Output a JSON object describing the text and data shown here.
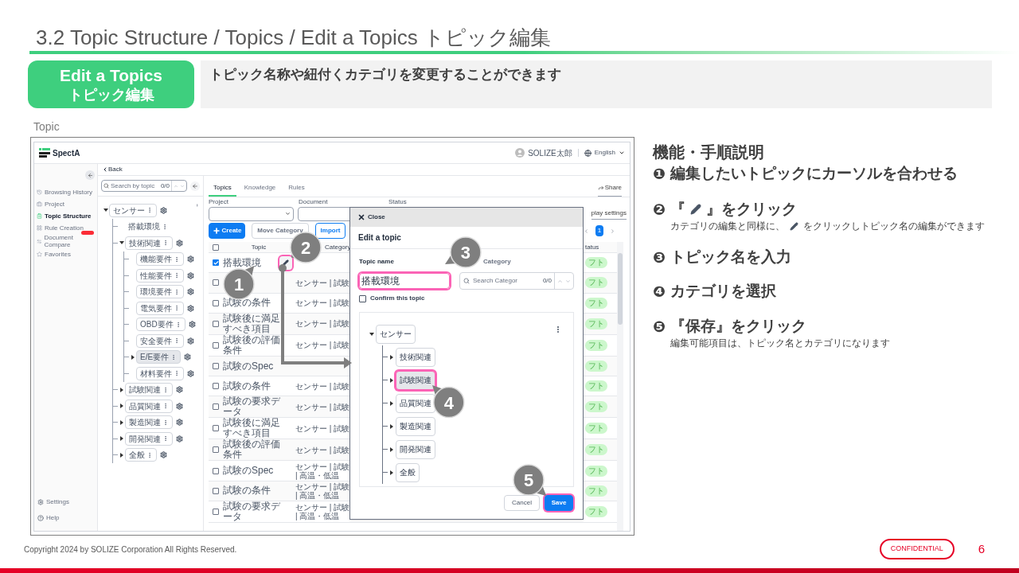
{
  "slide": {
    "title": "3.2 Topic Structure / Topics / Edit a Topics  トピック編集",
    "badge": [
      "Edit a Topics",
      "トピック編集"
    ],
    "summary": "トピック名称や紐付くカテゴリを変更することができます",
    "figure_label": "Topic"
  },
  "app": {
    "logo": "SpectA",
    "user": "SOLIZE太郎",
    "language": "English",
    "nav": [
      {
        "label": "Browsing History",
        "selected": false,
        "badge": false
      },
      {
        "label": "Project",
        "selected": false,
        "badge": false
      },
      {
        "label": "Topic Structure",
        "selected": true,
        "badge": false
      },
      {
        "label": "Rule Creation",
        "selected": false,
        "badge": false
      },
      {
        "label": "Document Compare",
        "selected": false,
        "badge": true
      },
      {
        "label": "Favorites",
        "selected": false,
        "badge": false
      }
    ],
    "nav_footer": [
      "Settings",
      "Help"
    ],
    "back": "Back",
    "tree_search": {
      "placeholder": "Search by topic",
      "count": "0/0"
    },
    "tree": [
      {
        "label": "センサー",
        "kind": "category",
        "expanded": true,
        "selected": false,
        "children": [
          {
            "label": "搭載環境",
            "kind": "topic",
            "selected": false
          },
          {
            "label": "技術関連",
            "kind": "category",
            "expanded": true,
            "selected": false,
            "children": [
              {
                "label": "機能要件",
                "kind": "category",
                "selected": false
              },
              {
                "label": "性能要件",
                "kind": "category",
                "selected": false
              },
              {
                "label": "環境要件",
                "kind": "category",
                "selected": false
              },
              {
                "label": "電気要件",
                "kind": "category",
                "selected": false
              },
              {
                "label": "OBD要件",
                "kind": "category",
                "selected": false
              },
              {
                "label": "安全要件",
                "kind": "category",
                "selected": false
              },
              {
                "label": "E/E要件",
                "kind": "category",
                "expanded": false,
                "selected": true
              },
              {
                "label": "材料要件",
                "kind": "category",
                "selected": false
              }
            ]
          },
          {
            "label": "試験関連",
            "kind": "category",
            "expanded": false,
            "selected": false
          },
          {
            "label": "品質関連",
            "kind": "category",
            "expanded": false,
            "selected": false
          },
          {
            "label": "製造関連",
            "kind": "category",
            "expanded": false,
            "selected": false
          },
          {
            "label": "開発関連",
            "kind": "category",
            "expanded": false,
            "selected": false
          },
          {
            "label": "全般",
            "kind": "category",
            "expanded": false,
            "selected": false
          }
        ]
      }
    ],
    "tabs": [
      {
        "label": "Topics",
        "selected": true
      },
      {
        "label": "Knowledge",
        "selected": false
      },
      {
        "label": "Rules",
        "selected": false
      }
    ],
    "share": "Share",
    "filters": [
      "Project",
      "Document",
      "Status"
    ],
    "actions": [
      {
        "label": "Create",
        "kind": "primary"
      },
      {
        "label": "Move Category",
        "kind": "disabled"
      },
      {
        "label": "Import",
        "kind": "outline"
      }
    ],
    "display_settings": "play settings",
    "page": "1",
    "columns": [
      "Topic",
      "Category",
      "tatus"
    ],
    "select_all": {
      "checked": false
    },
    "rows": [
      {
        "topic": "搭載環境",
        "checked": true,
        "hovered": true,
        "status": "フト"
      },
      {
        "category": [
          "センサー | 試験"
        ],
        "checked": false,
        "hovered": false,
        "status": "フト"
      },
      {
        "topic": "試験の条件",
        "category": [
          "センサー | 試験"
        ],
        "checked": false,
        "hovered": false,
        "status": "フト"
      },
      {
        "topic": "試験後に満足すべき項目",
        "category": [
          "センサー | 試験"
        ],
        "checked": false,
        "hovered": false,
        "status": "フト"
      },
      {
        "topic": "試験後の評価条件",
        "category": [
          "センサー | 試験"
        ],
        "checked": false,
        "hovered": false,
        "status": "フト"
      },
      {
        "topic": "試験のSpec",
        "checked": false,
        "hovered": false,
        "status": "フト"
      },
      {
        "topic": "試験の条件",
        "category": [
          "センサー | 試験"
        ],
        "checked": false,
        "hovered": false,
        "status": "フト"
      },
      {
        "topic": "試験の要求データ",
        "category": [
          "センサー | 試験"
        ],
        "checked": false,
        "hovered": false,
        "status": "フト"
      },
      {
        "topic": "試験後に満足すべき項目",
        "category": [
          "センサー | 試験"
        ],
        "checked": false,
        "hovered": false,
        "status": "フト"
      },
      {
        "topic": "試験後の評価条件",
        "category": [
          "センサー | 試験"
        ],
        "checked": false,
        "hovered": false,
        "status": "フト"
      },
      {
        "topic": "試験のSpec",
        "category": [
          "センサー | 試験",
          "| 高温・低温"
        ],
        "checked": false,
        "hovered": false,
        "status": "フト"
      },
      {
        "topic": "試験の条件",
        "category": [
          "センサー | 試験",
          "| 高温・低温"
        ],
        "checked": false,
        "hovered": false,
        "status": "フト"
      },
      {
        "topic": "試験の要求データ",
        "category": [
          "センサー | 試験",
          "| 高温・低温"
        ],
        "checked": false,
        "hovered": false,
        "status": "フト"
      }
    ]
  },
  "dialog": {
    "close": "Close",
    "title": "Edit a topic",
    "name_label": "Topic name",
    "name_value": "搭載環境",
    "name_highlighted": true,
    "category_label": "Category",
    "category_search": {
      "placeholder": "Search Categor",
      "count": "0/0"
    },
    "confirm": {
      "label": "Confirm this topic",
      "checked": false
    },
    "tree": {
      "label": "センサー",
      "expanded": true,
      "selected": false,
      "children": [
        {
          "label": "技術関連",
          "expanded": false,
          "selected": false
        },
        {
          "label": "試験関連",
          "expanded": false,
          "selected": true
        },
        {
          "label": "品質関連",
          "expanded": false,
          "selected": false
        },
        {
          "label": "製造関連",
          "expanded": false,
          "selected": false
        },
        {
          "label": "開発関連",
          "expanded": false,
          "selected": false
        },
        {
          "label": "全般",
          "expanded": false,
          "selected": false
        }
      ]
    },
    "buttons": [
      {
        "label": "Cancel",
        "kind": "secondary",
        "highlighted": false
      },
      {
        "label": "Save",
        "kind": "primary",
        "highlighted": true
      }
    ]
  },
  "callouts": [
    "1",
    "2",
    "3",
    "4",
    "5"
  ],
  "steps_heading": "機能・手順説明",
  "steps": [
    {
      "marker": "❶",
      "title": [
        "編集したいトピックにカーソルを合わせる"
      ]
    },
    {
      "marker": "❷",
      "title": [
        "『",
        "』をクリック"
      ],
      "note": [
        "カテゴリの編集と同様に、",
        "をクリックしトピック名の編集ができます"
      ]
    },
    {
      "marker": "❸",
      "title": [
        "トピック名を入力"
      ]
    },
    {
      "marker": "❹",
      "title": [
        "カテゴリを選択"
      ]
    },
    {
      "marker": "❺",
      "title": [
        "『保存』をクリック"
      ],
      "note": [
        "編集可能項目は、トピック名とカテゴリになります"
      ]
    }
  ],
  "footer": {
    "copyright": "Copyright 2024 by SOLIZE Corporation All Rights Reserved.",
    "confidential": "CONFIDENTIAL",
    "page": "6"
  }
}
